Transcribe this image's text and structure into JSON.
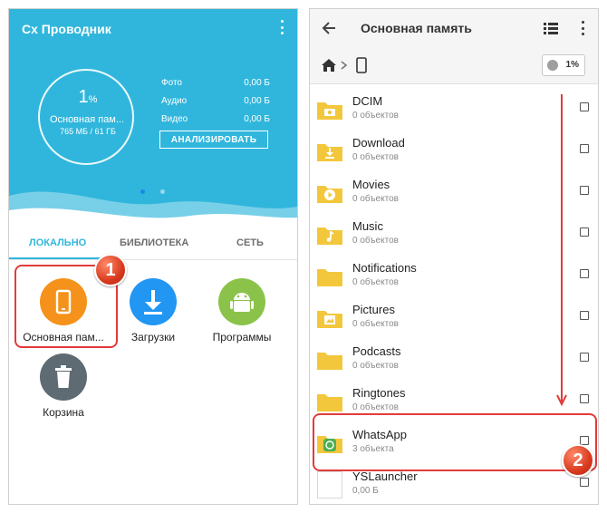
{
  "left_screen": {
    "app_title": "Cx Проводник",
    "storage_ring": {
      "percent": "1",
      "percent_unit": "%",
      "name": "Основная пам...",
      "size": "765 МБ / 61 ГБ",
      "used_fraction": 0.01
    },
    "stats": [
      {
        "label": "Фото",
        "value": "0,00 Б"
      },
      {
        "label": "Аудио",
        "value": "0,00 Б"
      },
      {
        "label": "Видео",
        "value": "0,00 Б"
      }
    ],
    "analyze_button": "АНАЛИЗИРОВАТЬ",
    "tabs": [
      {
        "label": "ЛОКАЛЬНО",
        "active": true
      },
      {
        "label": "БИБЛИОТЕКА",
        "active": false
      },
      {
        "label": "СЕТЬ",
        "active": false
      }
    ],
    "tiles": [
      {
        "label": "Основная пам...",
        "icon": "phone-icon",
        "color": "#f5921b"
      },
      {
        "label": "Загрузки",
        "icon": "download-icon",
        "color": "#2196f3"
      },
      {
        "label": "Программы",
        "icon": "android-icon",
        "color": "#8bc34a"
      },
      {
        "label": "Корзина",
        "icon": "trash-icon",
        "color": "#5f6b72"
      }
    ],
    "callout_number": "1"
  },
  "right_screen": {
    "title": "Основная память",
    "storage_chip": "1%",
    "callout_number": "2",
    "folders": [
      {
        "name": "DCIM",
        "info": "0 объектов",
        "icon": "camera-icon"
      },
      {
        "name": "Download",
        "info": "0 объектов",
        "icon": "download-icon"
      },
      {
        "name": "Movies",
        "info": "0 объектов",
        "icon": "play-icon"
      },
      {
        "name": "Music",
        "info": "0 объектов",
        "icon": "music-icon"
      },
      {
        "name": "Notifications",
        "info": "0 объектов",
        "icon": ""
      },
      {
        "name": "Pictures",
        "info": "0 объектов",
        "icon": "image-icon"
      },
      {
        "name": "Podcasts",
        "info": "0 объектов",
        "icon": ""
      },
      {
        "name": "Ringtones",
        "info": "0 объектов",
        "icon": ""
      },
      {
        "name": "WhatsApp",
        "info": "3 объекта",
        "icon": "whatsapp-icon"
      },
      {
        "name": "YSLauncher",
        "info": "0,00 Б",
        "icon": "file-icon"
      }
    ]
  },
  "colors": {
    "accent": "#30b6dc",
    "folder": "#f3c73c",
    "callout": "#e23b3b"
  }
}
